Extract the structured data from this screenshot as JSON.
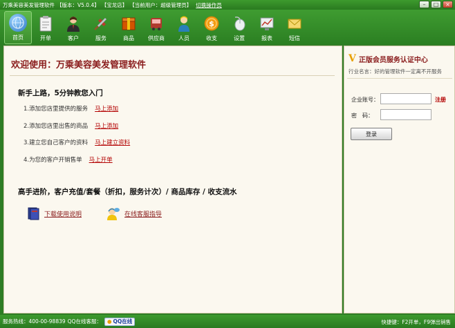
{
  "titlebar": {
    "app_name": "万乘美容美发管理软件",
    "version": "【版本：V5.0.4】",
    "store": "【宝龙店】",
    "current_user": "【当前用户：超级管理员】",
    "switch_operator": "切换操作员"
  },
  "window_controls": {
    "minimize": "–",
    "maximize": "□",
    "close": "×"
  },
  "toolbar": {
    "items": [
      {
        "label": "首页",
        "icon": "home-globe-icon",
        "color": "#3a8fd6"
      },
      {
        "label": "开单",
        "icon": "clipboard-icon",
        "color": "#f2f2f2"
      },
      {
        "label": "客户",
        "icon": "customer-icon",
        "color": "#7a4a2a"
      },
      {
        "label": "服务",
        "icon": "tools-icon",
        "color": "#c0392b"
      },
      {
        "label": "商品",
        "icon": "goods-box-icon",
        "color": "#d35400"
      },
      {
        "label": "供应商",
        "icon": "supplier-truck-icon",
        "color": "#b03a2e"
      },
      {
        "label": "人员",
        "icon": "staff-icon",
        "color": "#f1c40f"
      },
      {
        "label": "收支",
        "icon": "coin-icon",
        "color": "#e6a817"
      },
      {
        "label": "设置",
        "icon": "settings-mouse-icon",
        "color": "#dfe6e9"
      },
      {
        "label": "报表",
        "icon": "report-chart-icon",
        "color": "#ecf0f1"
      },
      {
        "label": "短信",
        "icon": "sms-envelope-icon",
        "color": "#f5d76e"
      }
    ]
  },
  "main": {
    "welcome": "欢迎使用：万乘美容美发管理软件",
    "quickstart_title": "新手上路，5分钟教您入门",
    "steps": [
      {
        "text": "1.添加您店里提供的服务",
        "link": "马上添加"
      },
      {
        "text": "2.添加您店里出售的商品",
        "link": "马上添加"
      },
      {
        "text": "3.建立您自己客户的资料",
        "link": "马上建立资料"
      },
      {
        "text": "4.为您的客户开销售单",
        "link": "马上开单"
      }
    ],
    "advanced_title": "高手进阶，客户充值/套餐（折扣，服务计次）/ 商品库存 / 收支流水",
    "download_manual": "下载使用说明",
    "online_support": "在线客服指导"
  },
  "side": {
    "title": "正版会员服务认证中心",
    "subtitle": "行业名言：好的管理软件一定离不开服务",
    "account_label": "企业账号：",
    "account_value": "",
    "account_placeholder": "",
    "register": "注册",
    "password_label": "密　码：",
    "password_value": "",
    "login_button": "登录"
  },
  "statusbar": {
    "hotline": "服务热线：400-00-98839",
    "qq_support": "QQ在线客服：",
    "qq_button": "QQ在线",
    "shortcuts": "快捷键：F2开单，F9弹出销售"
  },
  "colors": {
    "accent_green": "#2e7d25",
    "title_red": "#8a1c1c",
    "link_red": "#b30000",
    "panel_bg": "#fbf8ef"
  }
}
